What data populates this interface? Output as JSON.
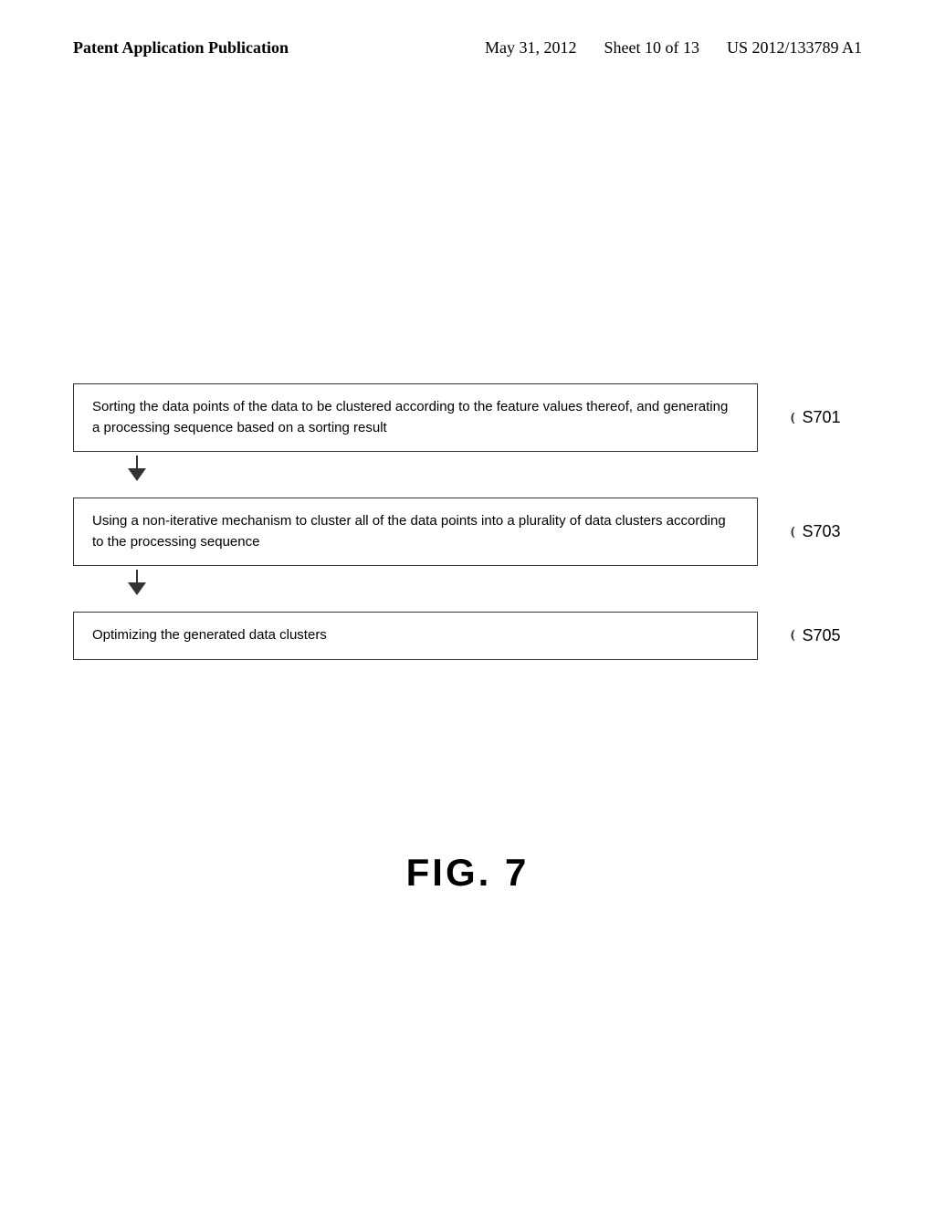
{
  "header": {
    "left_label": "Patent Application Publication",
    "date": "May 31, 2012",
    "sheet": "Sheet 10 of 13",
    "patent_number": "US 2012/133789 A1"
  },
  "flowchart": {
    "steps": [
      {
        "id": "s701",
        "label": "S701",
        "text": "Sorting the data points of the data to be clustered according to the feature values thereof, and generating a processing sequence based on a sorting result"
      },
      {
        "id": "s703",
        "label": "S703",
        "text": "Using a non-iterative mechanism to cluster all of the data points into a plurality of data clusters according to the processing sequence"
      },
      {
        "id": "s705",
        "label": "S705",
        "text": "Optimizing the generated data clusters"
      }
    ]
  },
  "figure_caption": "FIG. 7"
}
